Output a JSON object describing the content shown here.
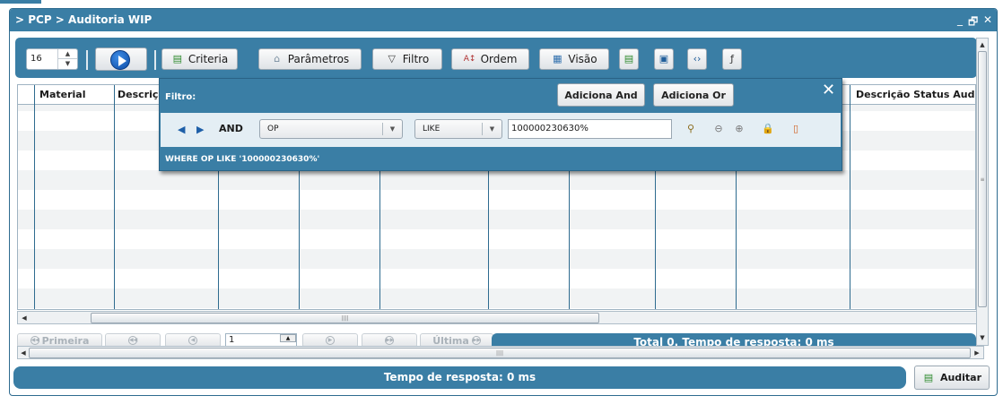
{
  "window": {
    "title": "> PCP > Auditoria WIP",
    "controls": [
      "_",
      "🗗",
      "✕"
    ]
  },
  "toolbar": {
    "page_size": "16",
    "buttons": {
      "criteria": "Criteria",
      "parametros": "Parâmetros",
      "filtro": "Filtro",
      "ordem": "Ordem",
      "visao": "Visão"
    }
  },
  "grid": {
    "columns": [
      "Material",
      "Descriçã",
      "Descrição Status Audito"
    ]
  },
  "filter_popup": {
    "title": "Filtro:",
    "add_and": "Adiciona And",
    "add_or": "Adiciona Or",
    "close": "✕",
    "condition": {
      "logic": "AND",
      "field": "OP",
      "operator": "LIKE",
      "value": "100000230630%"
    },
    "where_clause": "WHERE  OP LIKE '100000230630%'"
  },
  "pager": {
    "first": "Primeira",
    "last": "Última",
    "page": "1",
    "total_text": "Total 0. Tempo de resposta: 0 ms"
  },
  "status": {
    "response_text": "Tempo de resposta: 0 ms"
  },
  "actions": {
    "auditar": "Auditar"
  },
  "colors": {
    "accent": "#3a7ea5",
    "grid_line": "#2e6b8f"
  }
}
